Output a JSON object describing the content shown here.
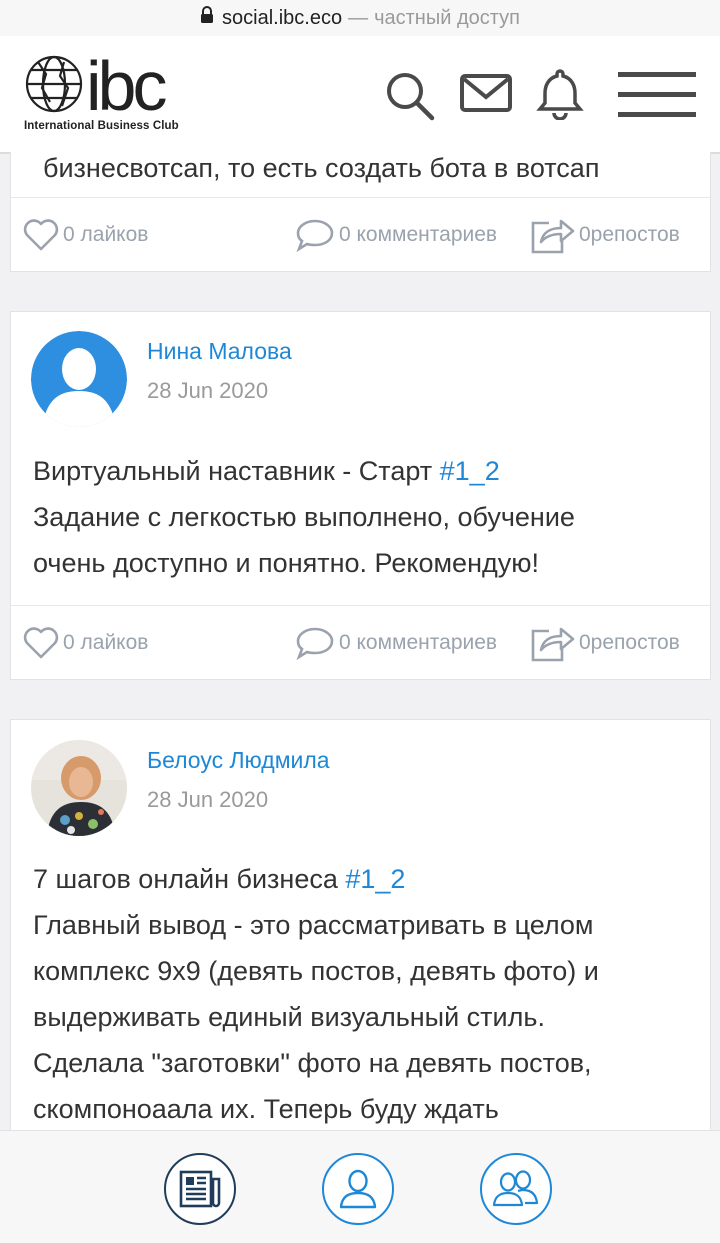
{
  "browser": {
    "host": "social.ibc.eco",
    "separator": "—",
    "access_label": "частный доступ"
  },
  "header": {
    "logo_text": "ibc",
    "tagline": "International Business Club",
    "icons": [
      "search-icon",
      "mail-icon",
      "bell-icon",
      "menu-icon"
    ]
  },
  "posts": [
    {
      "truncated_text": "бизнесвотсап, то есть создать бота в вотсап",
      "actions": {
        "likes": "0 лайков",
        "comments": "0 комментариев",
        "reposts": "0репостов"
      }
    },
    {
      "author": "Нина Малова",
      "date": "28 Jun 2020",
      "line1": "Виртуальный наставник - Старт ",
      "hashtag": "#1_2",
      "line2": "Задание с легкостью выполнено, обучение",
      "line3": "очень доступно и понятно. Рекомендую!",
      "actions": {
        "likes": "0 лайков",
        "comments": "0 комментариев",
        "reposts": "0репостов"
      }
    },
    {
      "author": "Белоус Людмила",
      "date": "28 Jun 2020",
      "line1": "7 шагов онлайн бизнеса ",
      "hashtag": "#1_2",
      "line2": "Главный вывод - это рассматривать в целом",
      "line3": "комплекс 9х9 (девять постов, девять фото)  и",
      "line4": "выдерживать единый визуальный стиль.",
      "line5": "Сделала \"заготовки\" фото на девять постов,",
      "line6": "скомпоноаала их. Теперь буду ждать"
    }
  ],
  "bottom_nav": [
    "news-icon",
    "profile-icon",
    "group-icon"
  ],
  "colors": {
    "accent": "#1e88d6",
    "dark": "#1f3d5a",
    "muted": "#9aa2ad"
  }
}
